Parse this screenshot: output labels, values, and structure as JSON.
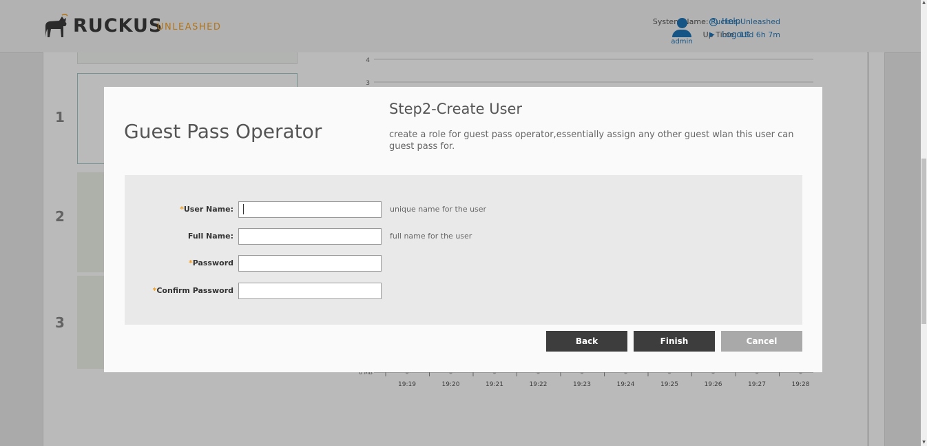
{
  "header": {
    "brand": "RUCKUS",
    "product": "UNLEASHED",
    "system_name_label": "System Name:",
    "system_name_value": "Ruckus-Unleashed",
    "uptime_label": "Up Time:",
    "uptime_value": "15d 6h 7m",
    "user": "admin",
    "help_label": "Help",
    "logout_label": "Logout"
  },
  "steps": {
    "step1": "1",
    "step2": "2",
    "step3": "3"
  },
  "chart_background": {
    "y_ticks": [
      "4",
      "3"
    ],
    "x_ticks": [
      "19:19",
      "19:20",
      "19:21",
      "19:22",
      "19:23",
      "19:24",
      "19:25",
      "19:26",
      "19:27",
      "19:28"
    ],
    "y_zero_label": "0 MB"
  },
  "modal": {
    "title": "Guest Pass Operator",
    "step_title": "Step2-Create User",
    "step_description": "create a role for guest pass operator,essentially assign any other guest wlan this user can guest pass for.",
    "required_mark": "*",
    "fields": {
      "user_name": {
        "label": "User Name:",
        "value": "",
        "hint": "unique name for the user"
      },
      "full_name": {
        "label": "Full Name:",
        "value": "",
        "hint": "full name for the user"
      },
      "password": {
        "label": "Password",
        "value": ""
      },
      "confirm_password": {
        "label": "Confirm Password",
        "value": ""
      }
    },
    "buttons": {
      "back": "Back",
      "finish": "Finish",
      "cancel": "Cancel"
    }
  },
  "colors": {
    "accent": "#f4a022",
    "link": "#1d75b8",
    "button_dark": "#3d3d3d",
    "button_disabled": "#a9a9a9"
  }
}
